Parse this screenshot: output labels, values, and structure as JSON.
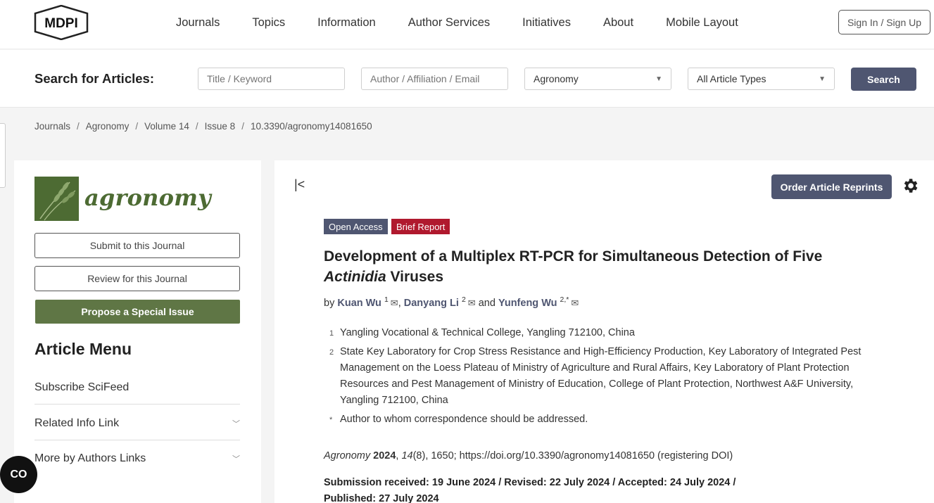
{
  "header": {
    "logo_text": "MDPI",
    "nav": [
      "Journals",
      "Topics",
      "Information",
      "Author Services",
      "Initiatives",
      "About",
      "Mobile Layout"
    ],
    "signin_label": "Sign In / Sign Up"
  },
  "search": {
    "label": "Search for Articles:",
    "title_placeholder": "Title / Keyword",
    "author_placeholder": "Author / Affiliation / Email",
    "journal_value": "Agronomy",
    "type_value": "All Article Types",
    "button_label": "Search"
  },
  "breadcrumb": [
    "Journals",
    "Agronomy",
    "Volume 14",
    "Issue 8",
    "10.3390/agronomy14081650"
  ],
  "sidebar": {
    "journal_name": "agronomy",
    "submit_label": "Submit to this Journal",
    "review_label": "Review for this Journal",
    "propose_label": "Propose a Special Issue",
    "menu_title": "Article Menu",
    "menu_items": [
      "Subscribe SciFeed",
      "Related Info Link",
      "More by Authors Links"
    ]
  },
  "cc_badge": "CO",
  "article": {
    "reprints_label": "Order Article Reprints",
    "badges": {
      "open_access": "Open Access",
      "type": "Brief Report"
    },
    "title_part1": "Development of a Multiplex RT-PCR for Simultaneous Detection of Five",
    "title_italic": "Actinidia",
    "title_part2": "Viruses",
    "by": "by",
    "and": "and",
    "authors": [
      {
        "name": "Kuan Wu",
        "sup": "1"
      },
      {
        "name": "Danyang Li",
        "sup": "2"
      },
      {
        "name": "Yunfeng Wu",
        "sup": "2,*"
      }
    ],
    "affiliations": [
      {
        "num": "1",
        "text": "Yangling Vocational & Technical College, Yangling 712100, China"
      },
      {
        "num": "2",
        "text": "State Key Laboratory for Crop Stress Resistance and High-Efficiency Production, Key Laboratory of Integrated Pest Management on the Loess Plateau of Ministry of Agriculture and Rural Affairs, Key Laboratory of Plant Protection Resources and Pest Management of Ministry of Education, College of Plant Protection, Northwest A&F University, Yangling 712100, China"
      },
      {
        "num": "*",
        "text": "Author to whom correspondence should be addressed."
      }
    ],
    "citation": {
      "journal": "Agronomy",
      "year": "2024",
      "volume": "14",
      "rest": "(8), 1650; https://doi.org/10.3390/agronomy14081650 (registering DOI)"
    },
    "dates_line1": "Submission received: 19 June 2024 / Revised: 22 July 2024 / Accepted: 24 July 2024 /",
    "dates_line2": "Published: 27 July 2024"
  },
  "colors": {
    "accent": "#4f5671",
    "journal_green": "#5f7645",
    "brief_report": "#b0192e"
  }
}
